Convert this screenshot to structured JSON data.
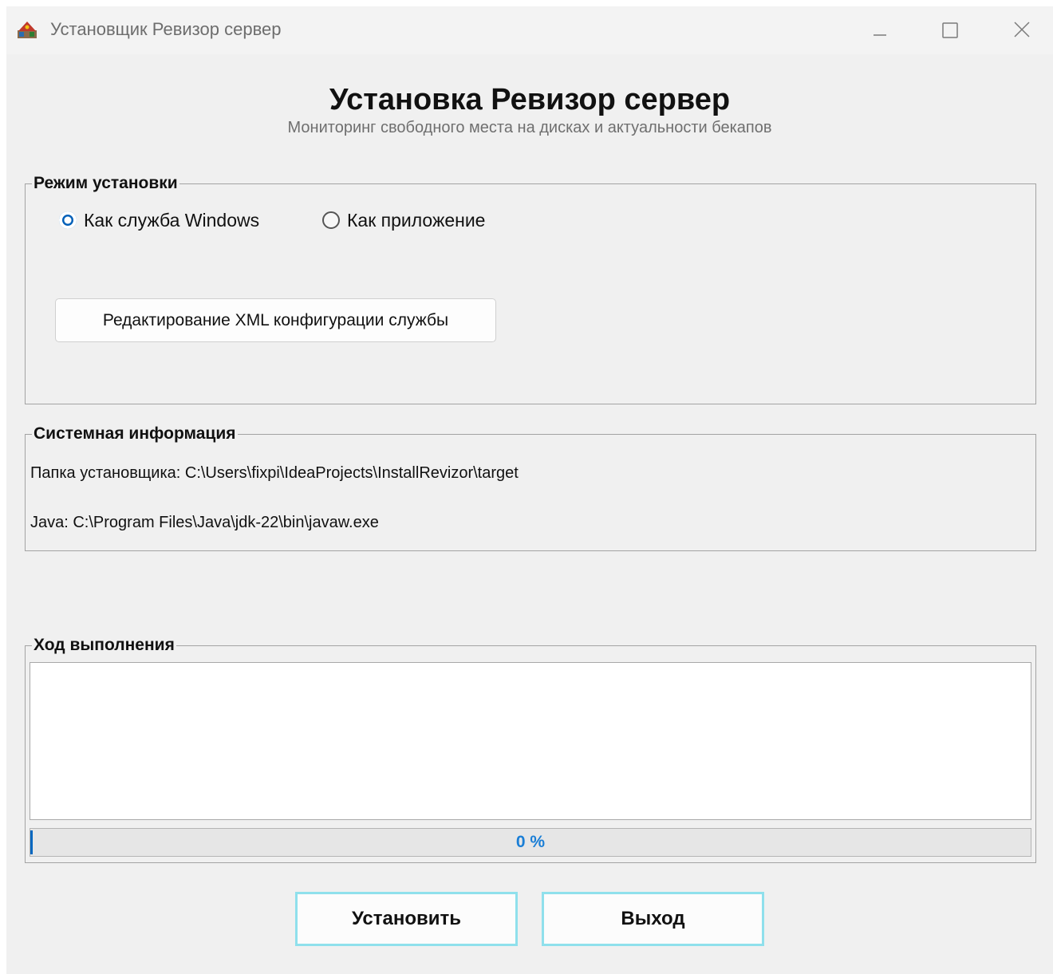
{
  "window": {
    "title": "Установщик Ревизор сервер",
    "icon": "installer-app-icon",
    "controls": [
      "minimize-icon",
      "maximize-icon",
      "close-icon"
    ]
  },
  "header": {
    "title": "Установка Ревизор сервер",
    "subtitle": "Мониторинг свободного места на дисках и актуальности бекапов"
  },
  "install_mode": {
    "legend": "Режим установки",
    "options": [
      {
        "label": "Как служба Windows",
        "selected": true
      },
      {
        "label": "Как приложение",
        "selected": false
      }
    ],
    "edit_xml_label": "Редактирование XML конфигурации службы"
  },
  "system_info": {
    "legend": "Системная информация",
    "installer_folder": "Папка установщика: C:\\Users\\fixpi\\IdeaProjects\\InstallRevizor\\target",
    "java_path": "Java: C:\\Program Files\\Java\\jdk-22\\bin\\javaw.exe"
  },
  "progress": {
    "legend": "Ход выполнения",
    "log_text": "",
    "percent_label": "0 %",
    "fraction": 0
  },
  "actions": {
    "install_label": "Установить",
    "exit_label": "Выход"
  },
  "colors": {
    "accent": "#005fb8",
    "progress_text": "#1a7ed6",
    "button_border": "#8fe0ec",
    "window_bg": "#f0f0f0"
  }
}
